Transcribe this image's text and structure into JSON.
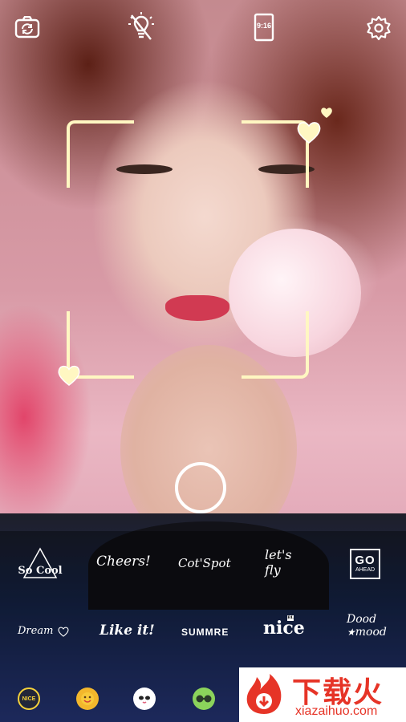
{
  "camera": {
    "aspect_ratio_label": "9:16",
    "icons": [
      "switch-camera-icon",
      "flash-off-icon",
      "aspect-ratio-icon",
      "settings-icon"
    ]
  },
  "stickers": {
    "row1": [
      {
        "label": "So Cool"
      },
      {
        "label": "Cheers!"
      },
      {
        "label": "Cot'Spot"
      },
      {
        "label_line1": "let's",
        "label_line2": "fly"
      },
      {
        "label_line1": "GO",
        "label_line2": "AHEAD"
      }
    ],
    "row2": [
      {
        "label": "Dream"
      },
      {
        "label": "Like it!"
      },
      {
        "label": "SUMMRE"
      },
      {
        "label": "nice",
        "badge": "BL"
      },
      {
        "label_line1": "Dood",
        "label_line2": "mood"
      }
    ]
  },
  "categories": [
    {
      "label": "NICE",
      "color": "#f6d23a"
    },
    {
      "label": "",
      "color": "#f3b72c"
    },
    {
      "label": "",
      "color": "#ffffff"
    },
    {
      "label": "",
      "color": "#8bd35b"
    }
  ],
  "watermark": {
    "brand": "下载火",
    "domain": "xiazaihuo.com",
    "color": "#e63427"
  }
}
